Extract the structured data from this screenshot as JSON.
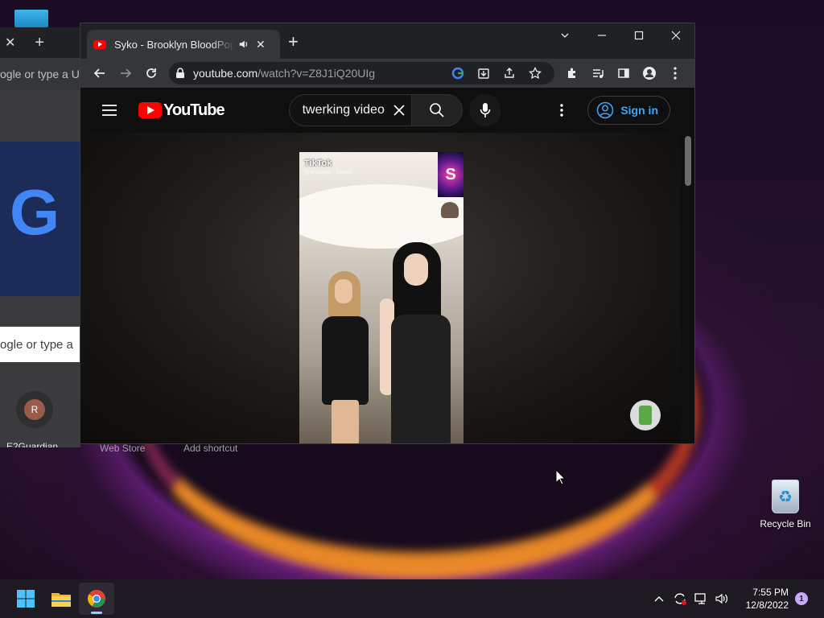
{
  "desktop": {
    "recycle_bin_label": "Recycle Bin"
  },
  "background_window": {
    "address_placeholder": "ogle or type a URL",
    "search_placeholder": "ogle or type a",
    "shortcut_avatar_letter": "R",
    "shortcut_label": "E2Guardian",
    "peek_labels": [
      "Web Store",
      "Add shortcut"
    ]
  },
  "browser": {
    "tab_title": "Syko - Brooklyn BloodPop TikTok",
    "url_host": "youtube.com",
    "url_path": "/watch?v=Z8J1iQ20UIg"
  },
  "youtube": {
    "logo_text": "YouTube",
    "search_query": "twerking video",
    "sign_in_label": "Sign in"
  },
  "video": {
    "overlay_brand": "TikTok",
    "overlay_handle": "@brooklyn · kawaii",
    "sticker_letter": "S"
  },
  "taskbar": {
    "time": "7:55 PM",
    "date": "12/8/2022",
    "notification_count": "1"
  },
  "colors": {
    "youtube_red": "#ff0000",
    "link_blue": "#3ea6ff",
    "chrome_dark": "#202124",
    "toolbar_dark": "#35363a"
  },
  "icons": [
    "windows-start-icon",
    "file-explorer-icon",
    "chrome-icon",
    "recycle-bin-icon",
    "back-arrow-icon",
    "forward-arrow-icon",
    "reload-icon",
    "lock-icon",
    "google-icon",
    "install-icon",
    "share-icon",
    "star-icon",
    "extensions-icon",
    "media-icon",
    "side-panel-icon",
    "profile-icon",
    "kebab-menu-icon",
    "hamburger-icon",
    "search-icon",
    "mic-icon",
    "clear-icon",
    "account-icon",
    "speaker-icon",
    "close-icon",
    "plus-icon",
    "minimize-icon",
    "maximize-icon",
    "chevron-up-icon",
    "sync-icon",
    "network-icon",
    "volume-icon"
  ]
}
